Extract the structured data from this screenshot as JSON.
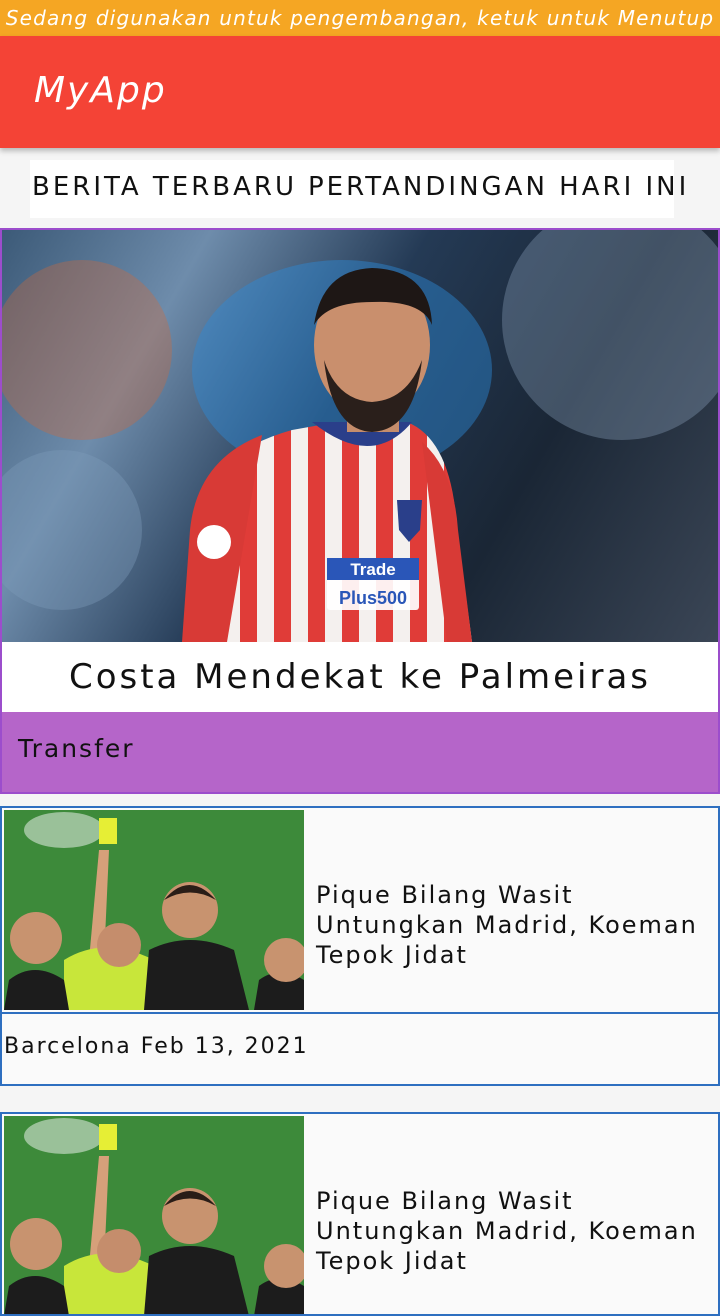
{
  "dev_banner": "Sedang digunakan untuk pengembangan, ketuk untuk Menutup",
  "app_bar": {
    "title": "MyApp"
  },
  "tabs": [
    {
      "label": "BERITA TERBARU"
    },
    {
      "label": "PERTANDINGAN HARI INI"
    }
  ],
  "featured": {
    "headline": "Costa Mendekat ke Palmeiras",
    "category": "Transfer",
    "jersey_sponsor_line1": "Trade",
    "jersey_sponsor_line2": "Plus500"
  },
  "news": [
    {
      "title": "Pique Bilang Wasit Untungkan Madrid, Koeman Tepok Jidat",
      "meta": "Barcelona Feb 13, 2021"
    },
    {
      "title": "Pique Bilang Wasit Untungkan Madrid, Koeman Tepok Jidat"
    }
  ],
  "colors": {
    "dev_banner": "#f5a623",
    "app_bar": "#f44336",
    "category_bar": "#b565c9",
    "card_border": "#2e6fc0",
    "featured_border": "#9c4dcc"
  }
}
